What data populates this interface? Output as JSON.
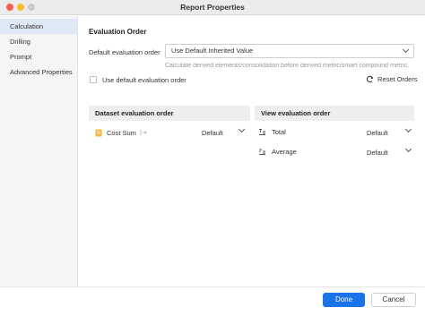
{
  "window": {
    "title": "Report Properties"
  },
  "sidebar": {
    "items": [
      {
        "label": "Calculation",
        "active": true
      },
      {
        "label": "Drilling",
        "active": false
      },
      {
        "label": "Prompt",
        "active": false
      },
      {
        "label": "Advanced Properties",
        "active": false
      }
    ]
  },
  "main": {
    "section_title": "Evaluation Order",
    "default_order": {
      "label": "Default evaluation order",
      "value": "Use Default Inherited Value",
      "hint": "Calculate derived elements/consolidation before derived metric/smart compound metric,"
    },
    "use_default_checkbox": {
      "label": "Use default evaluation order",
      "checked": false
    },
    "reset_button": {
      "label": "Reset Orders",
      "icon": "refresh-icon"
    },
    "dataset_panel": {
      "header": "Dataset evaluation order",
      "items": [
        {
          "label": "Cost Sum",
          "value": "Default",
          "icon": "dataset-icon"
        }
      ]
    },
    "view_panel": {
      "header": "View evaluation order",
      "items": [
        {
          "label": "Total",
          "value": "Default",
          "icon": "total-icon"
        },
        {
          "label": "Average",
          "value": "Default",
          "icon": "average-icon"
        }
      ]
    }
  },
  "footer": {
    "done_label": "Done",
    "cancel_label": "Cancel"
  },
  "colors": {
    "accent": "#1a73e8",
    "sidebar_active": "#dfe8f5"
  }
}
